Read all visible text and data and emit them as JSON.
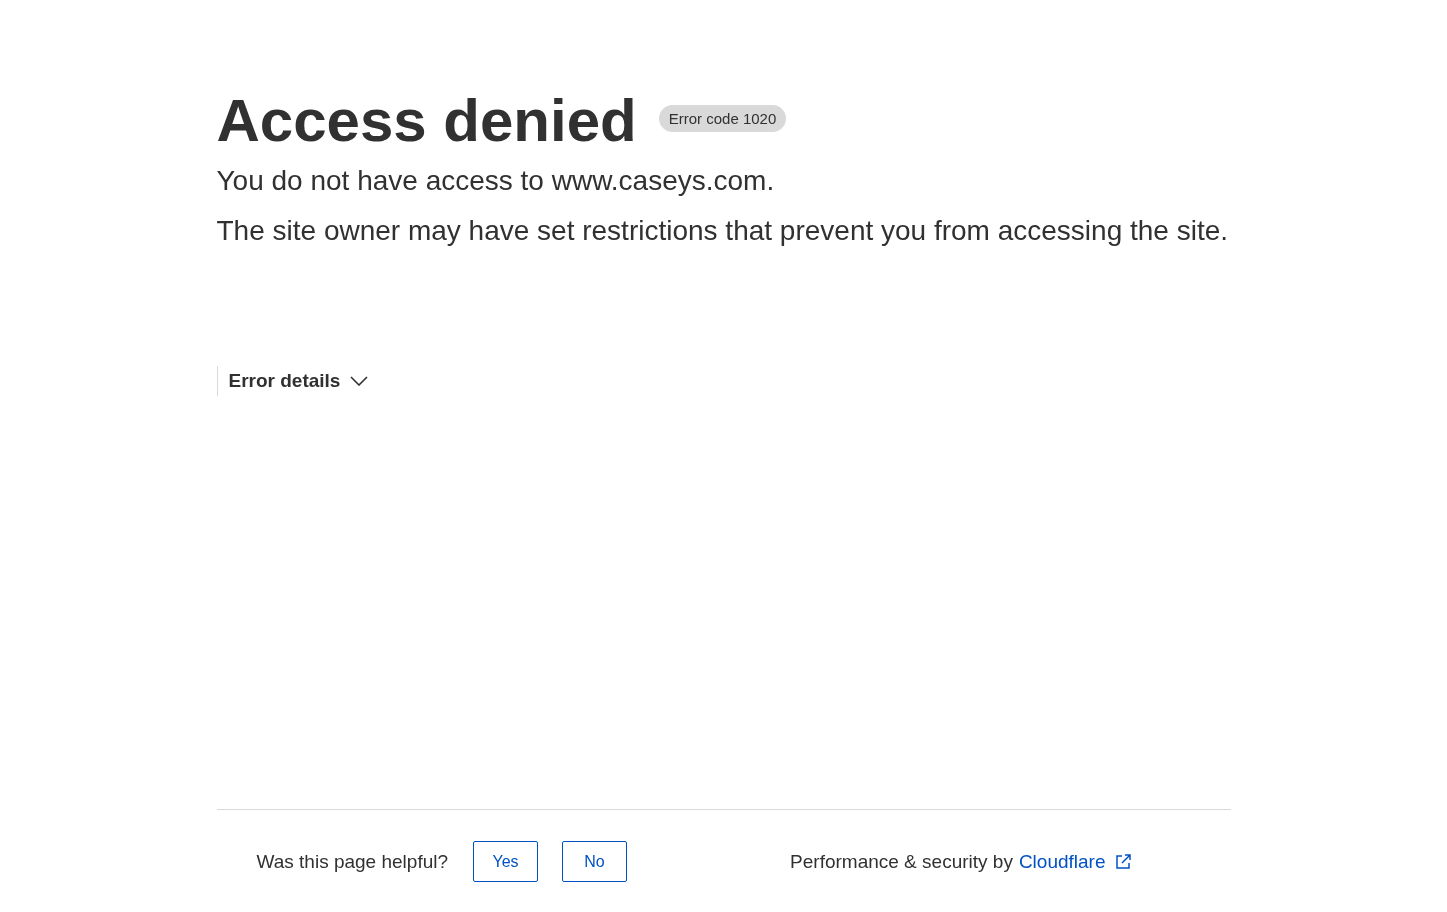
{
  "heading": {
    "title": "Access denied",
    "badge": "Error code 1020"
  },
  "messages": [
    "You do not have access to www.caseys.com.",
    "The site owner may have set restrictions that prevent you from accessing the site."
  ],
  "error_details": {
    "label": "Error details",
    "expanded": false
  },
  "footer": {
    "question": "Was this page helpful?",
    "buttons": [
      "Yes",
      "No"
    ],
    "credit": "Performance & security by",
    "link": "Cloudflare"
  }
}
